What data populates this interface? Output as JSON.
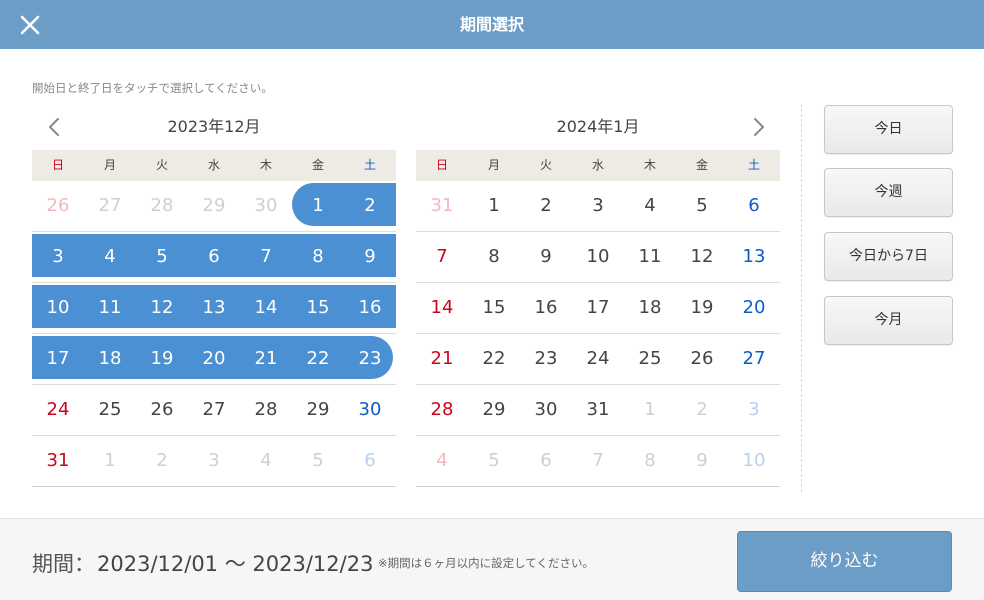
{
  "header": {
    "title": "期間選択",
    "close_icon": "close-icon"
  },
  "instruction": "開始日と終了日をタッチで選択してください。",
  "weekdays": [
    "日",
    "月",
    "火",
    "水",
    "木",
    "金",
    "土"
  ],
  "calendars": [
    {
      "title": "2023年12月",
      "weeks": [
        [
          "26",
          "27",
          "28",
          "29",
          "30",
          "1",
          "2"
        ],
        [
          "3",
          "4",
          "5",
          "6",
          "7",
          "8",
          "9"
        ],
        [
          "10",
          "11",
          "12",
          "13",
          "14",
          "15",
          "16"
        ],
        [
          "17",
          "18",
          "19",
          "20",
          "21",
          "22",
          "23"
        ],
        [
          "24",
          "25",
          "26",
          "27",
          "28",
          "29",
          "30"
        ],
        [
          "31",
          "1",
          "2",
          "3",
          "4",
          "5",
          "6"
        ]
      ]
    },
    {
      "title": "2024年1月",
      "weeks": [
        [
          "31",
          "1",
          "2",
          "3",
          "4",
          "5",
          "6"
        ],
        [
          "7",
          "8",
          "9",
          "10",
          "11",
          "12",
          "13"
        ],
        [
          "14",
          "15",
          "16",
          "17",
          "18",
          "19",
          "20"
        ],
        [
          "21",
          "22",
          "23",
          "24",
          "25",
          "26",
          "27"
        ],
        [
          "28",
          "29",
          "30",
          "31",
          "1",
          "2",
          "3"
        ],
        [
          "4",
          "5",
          "6",
          "7",
          "8",
          "9",
          "10"
        ]
      ]
    }
  ],
  "quick_buttons": [
    "今日",
    "今週",
    "今日から7日",
    "今月"
  ],
  "footer": {
    "period_label": "期間：",
    "period_value": "2023/12/01 〜 2023/12/23",
    "note": "※期間は６ヶ月以内に設定してください。",
    "filter_button": "絞り込む"
  },
  "colors": {
    "header": "#6b9dc7",
    "selection": "#4a90d2",
    "sunday": "#d0021b",
    "saturday": "#0b5dc5"
  }
}
